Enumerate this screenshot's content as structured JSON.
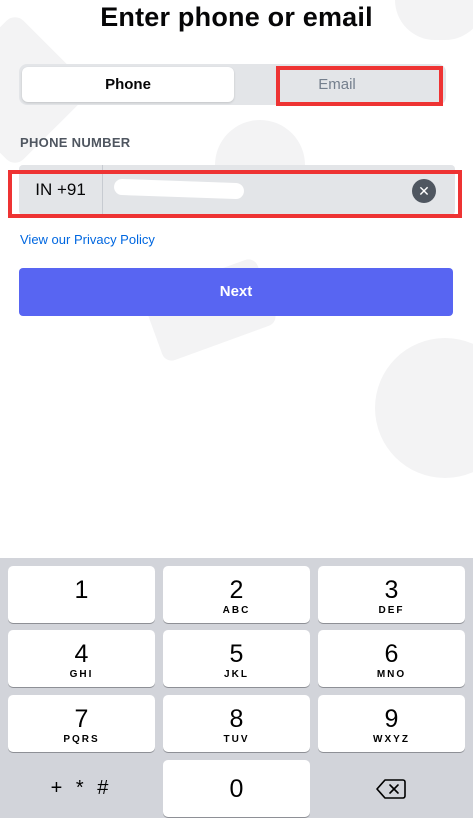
{
  "title": "Enter phone or email",
  "toggle": {
    "phone_label": "Phone",
    "email_label": "Email"
  },
  "phone_field": {
    "label": "PHONE NUMBER",
    "country_code": "IN +91",
    "value": ""
  },
  "privacy_link": "View our Privacy Policy",
  "next_button": "Next",
  "keypad": {
    "keys": [
      {
        "num": "1",
        "letters": ""
      },
      {
        "num": "2",
        "letters": "ABC"
      },
      {
        "num": "3",
        "letters": "DEF"
      },
      {
        "num": "4",
        "letters": "GHI"
      },
      {
        "num": "5",
        "letters": "JKL"
      },
      {
        "num": "6",
        "letters": "MNO"
      },
      {
        "num": "7",
        "letters": "PQRS"
      },
      {
        "num": "8",
        "letters": "TUV"
      },
      {
        "num": "9",
        "letters": "WXYZ"
      }
    ],
    "symbols": "+ * #",
    "zero": "0"
  },
  "colors": {
    "accent": "#5865f2",
    "highlight": "#ee3333",
    "link": "#0067e0"
  },
  "icons": {
    "clear": "close-circle-icon",
    "backspace": "backspace-icon"
  }
}
